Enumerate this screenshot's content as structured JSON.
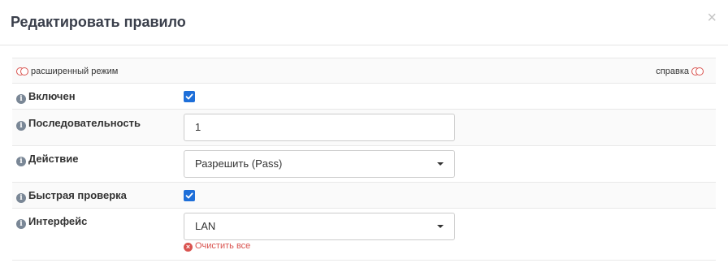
{
  "modal": {
    "title": "Редактировать правило",
    "close_glyph": "×"
  },
  "options": {
    "advanced_mode_label": "расширенный режим",
    "help_label": "справка"
  },
  "fields": {
    "enabled": {
      "label": "Включен",
      "checked": true
    },
    "sequence": {
      "label": "Последовательность",
      "value": "1"
    },
    "action": {
      "label": "Действие",
      "selected": "Разрешить (Pass)"
    },
    "quick": {
      "label": "Быстрая проверка",
      "checked": true
    },
    "interface": {
      "label": "Интерфейс",
      "selected": "LAN",
      "clear_all_label": "Очистить все"
    }
  },
  "icons": {
    "info": "info-circle-icon",
    "toggle": "toggle-off-icon",
    "clear": "times-circle-icon",
    "dropdown": "caret-down-icon"
  },
  "colors": {
    "checkbox": "#1e6fd9",
    "toggle": "#d9534f",
    "clear_all": "#d9534f",
    "info_icon": "#7a8796"
  }
}
